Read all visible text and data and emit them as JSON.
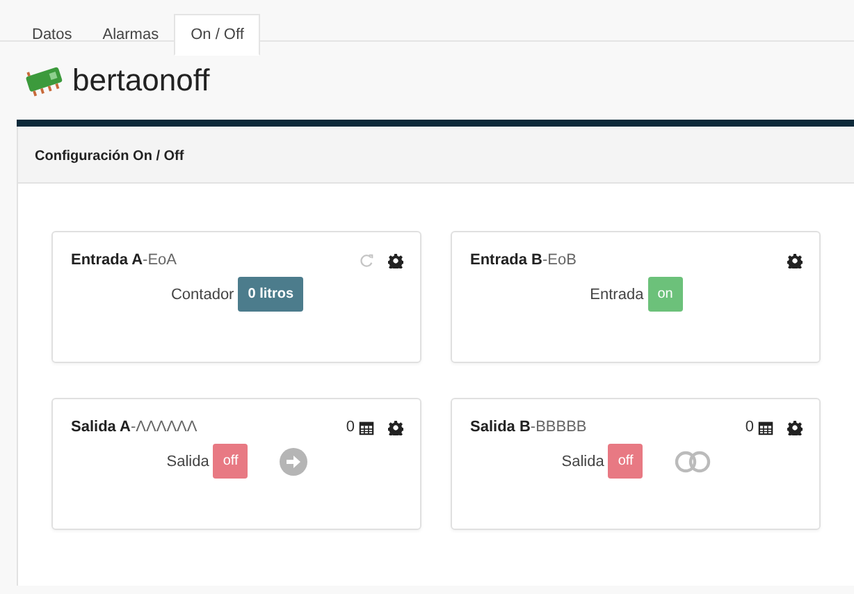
{
  "tabs": [
    {
      "label": "Datos",
      "selected": false
    },
    {
      "label": "Alarmas",
      "selected": false
    },
    {
      "label": "On / Off",
      "selected": true
    }
  ],
  "header": {
    "title": "bertaonoff"
  },
  "panel": {
    "title": "Configuración On / Off",
    "cards": [
      {
        "kind": "counter",
        "title": "**Entrada A**-EoA",
        "refresh": true,
        "label": "Contador",
        "value": "0 litros"
      },
      {
        "kind": "input",
        "title": "**Entrada B**-EoB",
        "refresh": false,
        "label": "Entrada",
        "value": "on",
        "on": true
      },
      {
        "kind": "output",
        "title": "**Salida A**-ΛΛΛΛΛΛ",
        "schedules": "0",
        "label": "Salida",
        "value": "off",
        "on": false,
        "action": {
          "kind": "arrow"
        }
      },
      {
        "kind": "output",
        "title": "**Salida B**-BBBBB",
        "schedules": "0",
        "label": "Salida",
        "value": "off",
        "on": false,
        "action": {
          "kind": "toggle"
        }
      }
    ]
  }
}
